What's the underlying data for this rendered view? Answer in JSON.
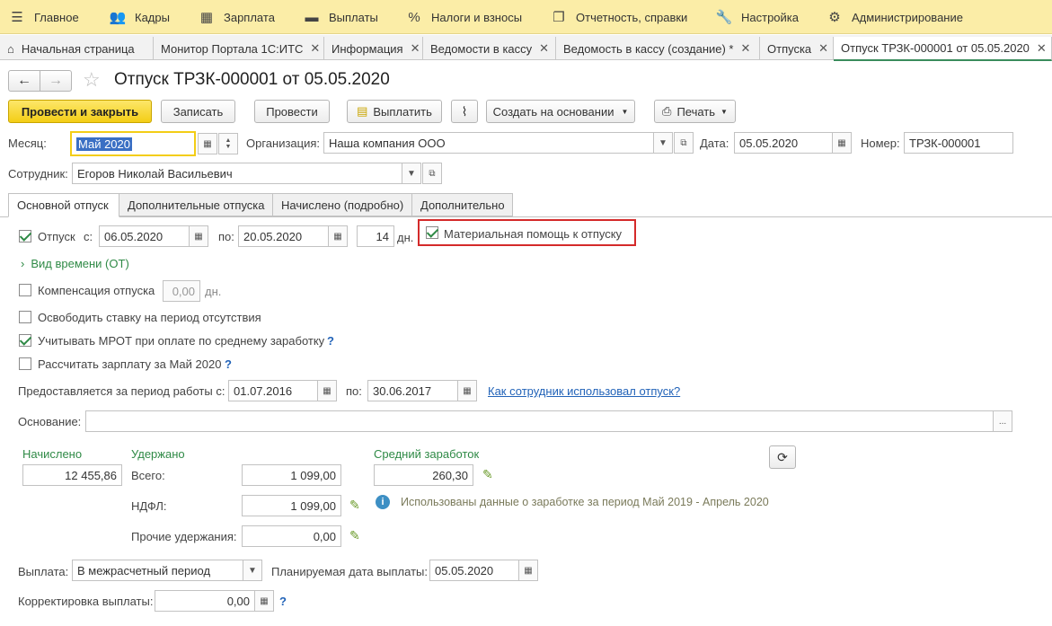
{
  "menu": [
    {
      "label": "Главное",
      "icon": "hamburger-icon"
    },
    {
      "label": "Кадры",
      "icon": "people-icon"
    },
    {
      "label": "Зарплата",
      "icon": "calculator-icon"
    },
    {
      "label": "Выплаты",
      "icon": "wallet-icon"
    },
    {
      "label": "Налоги и взносы",
      "icon": "percent-icon"
    },
    {
      "label": "Отчетность, справки",
      "icon": "reports-icon"
    },
    {
      "label": "Настройка",
      "icon": "wrench-icon"
    },
    {
      "label": "Администрирование",
      "icon": "gear-icon"
    }
  ],
  "tabs": [
    {
      "label": "Начальная страница"
    },
    {
      "label": "Монитор Портала 1С:ИТС"
    },
    {
      "label": "Информация"
    },
    {
      "label": "Ведомости в кассу"
    },
    {
      "label": "Ведомость в кассу (создание) *"
    },
    {
      "label": "Отпуска"
    },
    {
      "label": "Отпуск ТРЗК-000001 от 05.05.2020"
    }
  ],
  "doc": {
    "title": "Отпуск ТРЗК-000001 от 05.05.2020"
  },
  "toolbar": {
    "post_close": "Провести и закрыть",
    "save": "Записать",
    "post": "Провести",
    "pay": "Выплатить",
    "create_based": "Создать на основании",
    "print": "Печать"
  },
  "header": {
    "month_label": "Месяц:",
    "month_value": "Май 2020",
    "org_label": "Организация:",
    "org_value": "Наша компания ООО",
    "date_label": "Дата:",
    "date_value": "05.05.2020",
    "number_label": "Номер:",
    "number_value": "ТРЗК-000001",
    "employee_label": "Сотрудник:",
    "employee_value": "Егоров Николай Васильевич"
  },
  "form_tabs": [
    {
      "label": "Основной отпуск"
    },
    {
      "label": "Дополнительные отпуска"
    },
    {
      "label": "Начислено (подробно)"
    },
    {
      "label": "Дополнительно"
    }
  ],
  "vacation": {
    "label": "Отпуск",
    "from_label": "с:",
    "from": "06.05.2020",
    "to_label": "по:",
    "to": "20.05.2020",
    "days": "14",
    "days_unit": "дн.",
    "material_aid": "Материальная помощь к отпуску",
    "time_type": "Вид времени (ОТ)",
    "compensation": "Компенсация отпуска",
    "compensation_value": "0,00",
    "compensation_unit": "дн.",
    "free_rate": "Освободить ставку на период отсутствия",
    "mrot": "Учитывать МРОТ при оплате по среднему заработку",
    "calc_salary": "Рассчитать зарплату за Май 2020",
    "help": "?",
    "period_label": "Предоставляется за период работы с:",
    "period_from": "01.07.2016",
    "period_to_label": "по:",
    "period_to": "30.06.2017",
    "usage_link": "Как сотрудник использовал отпуск?",
    "basis_label": "Основание:",
    "basis_value": "",
    "ellipsis": "..."
  },
  "totals": {
    "accrued_label": "Начислено",
    "accrued": "12 455,86",
    "withheld_label": "Удержано",
    "total_label": "Всего:",
    "total": "1 099,00",
    "ndfl_label": "НДФЛ:",
    "ndfl": "1 099,00",
    "other_label": "Прочие удержания:",
    "other": "0,00",
    "avg_label": "Средний заработок",
    "avg": "260,30",
    "info": "Использованы данные о заработке за период Май 2019 - Апрель 2020"
  },
  "payment": {
    "label": "Выплата:",
    "value": "В межрасчетный период",
    "planned_label": "Планируемая дата выплаты:",
    "planned": "05.05.2020",
    "correction_label": "Корректировка выплаты:",
    "correction": "0,00"
  },
  "colors": {
    "menu_bg": "#fbeda7",
    "primary_btn": "#f3cd16",
    "accent_green": "#2f8a46",
    "highlight_red": "#d42a2a",
    "link": "#2263b8"
  }
}
